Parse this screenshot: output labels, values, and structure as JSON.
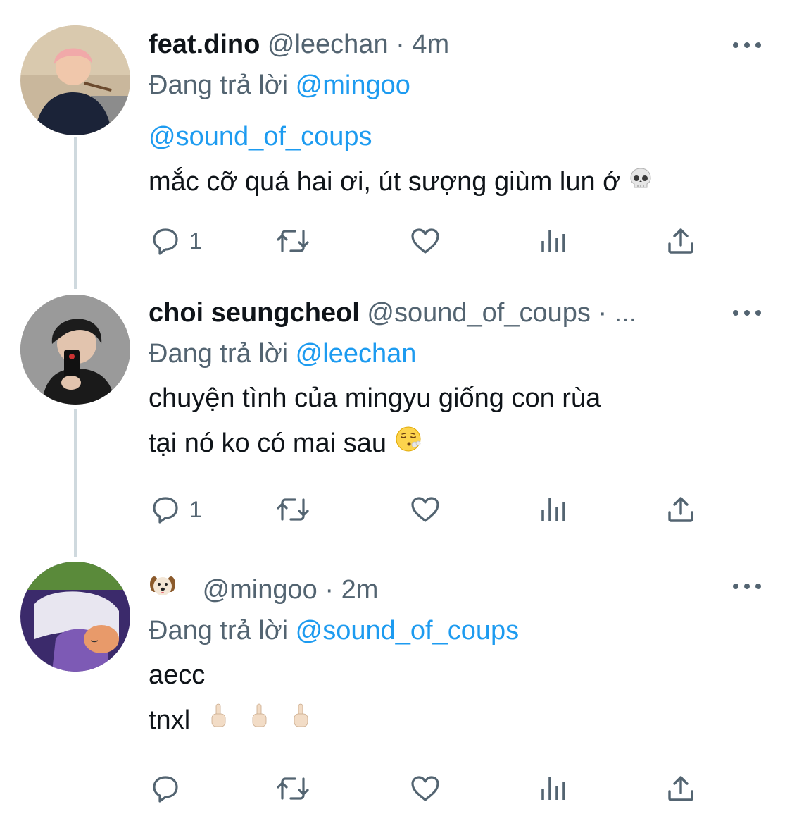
{
  "tweets": [
    {
      "name": "feat.dino",
      "handle": "@leechan",
      "separator": "·",
      "time": "4m",
      "reply_prefix": "Đang trả lời",
      "reply_to": "@mingoo",
      "mention_line": "@sound_of_coups",
      "text": "mắc cỡ quá hai ơi, út sượng giùm lun ớ",
      "emoji": "skull-icon",
      "reply_count": "1"
    },
    {
      "name": "choi seungcheol",
      "handle": "@sound_of_coups",
      "separator": "·",
      "time": "...",
      "reply_prefix": "Đang trả lời",
      "reply_to": "@leechan",
      "text_line1": "chuyện tình của mingyu giống con rùa",
      "text_line2": "tại nó ko có mai sau",
      "emoji": "exhaling-face-icon",
      "reply_count": "1"
    },
    {
      "name_emoji": "dog-face-icon",
      "handle": "@mingoo",
      "separator": "·",
      "time": "2m",
      "reply_prefix": "Đang trả lời",
      "reply_to": "@sound_of_coups",
      "text_line1": "aecc",
      "text_line2": "tnxl",
      "emoji": "middle-finger-icon",
      "reply_count": ""
    }
  ],
  "colors": {
    "text": "#0f1419",
    "muted": "#536471",
    "link": "#1d9bf0",
    "thread_line": "#cfd9de"
  }
}
